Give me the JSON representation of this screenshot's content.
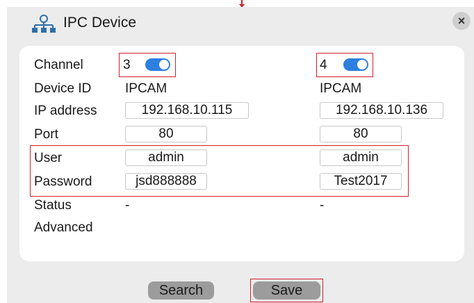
{
  "dialog": {
    "title": "IPC Device",
    "close_glyph": "×",
    "title_icon": "network-icon",
    "close_icon": "close-icon"
  },
  "labels": {
    "channel": "Channel",
    "device_id": "Device ID",
    "ip_address": "IP address",
    "port": "Port",
    "user": "User",
    "password": "Password",
    "status": "Status",
    "advanced": "Advanced"
  },
  "channels": [
    {
      "channel": "3",
      "enabled": true,
      "device_id": "IPCAM",
      "ip_address": "192.168.10.115",
      "port": "80",
      "user": "admin",
      "password": "jsd888888",
      "status": "-"
    },
    {
      "channel": "4",
      "enabled": true,
      "device_id": "IPCAM",
      "ip_address": "192.168.10.136",
      "port": "80",
      "user": "admin",
      "password": "Test2017",
      "status": "-"
    }
  ],
  "buttons": {
    "search": "Search",
    "save": "Save"
  },
  "colors": {
    "toggle_on": "#2d7fe0",
    "highlight": "#d0202c",
    "button_bg": "#9c9c9c",
    "dialog_bg": "#ececec",
    "icon": "#2f6fa8"
  }
}
